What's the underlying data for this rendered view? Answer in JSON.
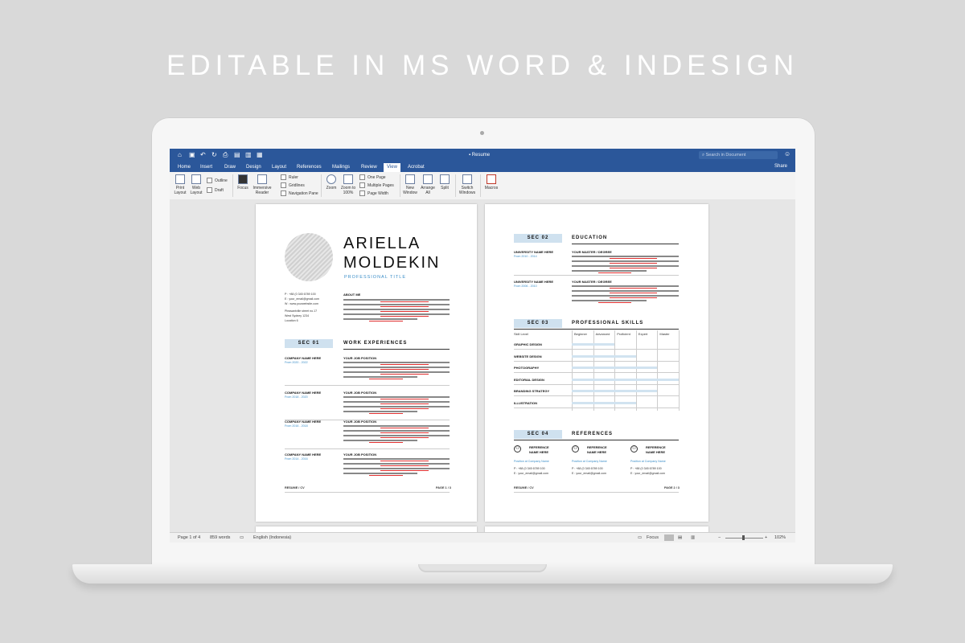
{
  "headline": "EDITABLE IN MS WORD & INDESIGN",
  "window": {
    "doc_title": "Resume",
    "search_placeholder": "Search in Document"
  },
  "tabs": [
    "Home",
    "Insert",
    "Draw",
    "Design",
    "Layout",
    "References",
    "Mailings",
    "Review",
    "View",
    "Acrobat"
  ],
  "active_tab": "View",
  "share_label": "Share",
  "ribbon": {
    "print_layout": "Print Layout",
    "web_layout": "Web Layout",
    "outline": "Outline",
    "draft": "Draft",
    "focus": "Focus",
    "immersive_reader": "Immersive Reader",
    "ruler": "Ruler",
    "gridlines": "Gridlines",
    "navigation_pane": "Navigation Pane",
    "zoom": "Zoom",
    "zoom_100": "Zoom to 100%",
    "one_page": "One Page",
    "multiple_pages": "Multiple Pages",
    "page_width": "Page Width",
    "new_window": "New Window",
    "arrange_all": "Arrange All",
    "split": "Split",
    "switch_windows": "Switch Windows",
    "macros": "Macros"
  },
  "status": {
    "page": "Page 1 of 4",
    "words": "859 words",
    "language": "English (Indonesia)",
    "focus": "Focus",
    "zoom": "102%",
    "zoom_minus": "−",
    "zoom_plus": "+"
  },
  "resume": {
    "first_name": "ARIELLA",
    "last_name": "MOLDEKIN",
    "professional_title": "PROFESSIONAL TITLE",
    "contact": [
      "P : +88 (0 345 6789 100",
      "E : your_email@gmail.com",
      "W : www.yourwebsite.com"
    ],
    "address": [
      "Pleasantville street no.17",
      "West Sydney 1234",
      "Location 6"
    ],
    "about_title": "ABOUT ME",
    "sec01": "SEC 01",
    "work_title": "WORK EXPERIENCES",
    "jobs": [
      {
        "company": "COMPANY NAME HERE",
        "dates": "From 2020 - 2022",
        "position": "YOUR JOB POSITION"
      },
      {
        "company": "COMPANY NAME HERE",
        "dates": "From 2018 - 2020",
        "position": "YOUR JOB POSITION"
      },
      {
        "company": "COMPANY NAME HERE",
        "dates": "From 2016 - 2018",
        "position": "YOUR JOB POSITION"
      },
      {
        "company": "COMPANY NAME HERE",
        "dates": "From 2014 - 2016",
        "position": "YOUR JOB POSITION"
      }
    ],
    "footer_left": "RESUME / CV",
    "footer_page1": "PAGE 1 / 3",
    "sec02": "SEC 02",
    "education_title": "EDUCATION",
    "education": [
      {
        "school": "UNIVERSITY NAME HERE",
        "dates": "From 2010 - 2014",
        "degree": "YOUR MASTER / DEGREE"
      },
      {
        "school": "UNIVERSITY NAME HERE",
        "dates": "From 2006 - 2010",
        "degree": "YOUR MASTER / DEGREE"
      }
    ],
    "sec03": "SEC 03",
    "skills_title": "PROFESSIONAL SKILLS",
    "skill_level_label": "Skill Level",
    "levels": [
      "Beginner",
      "Advanced",
      "Proficient",
      "Expert",
      "Master"
    ],
    "skills": [
      {
        "name": "GRAPHIC DESIGN",
        "level": 0.4
      },
      {
        "name": "WEBSITE DESIGN",
        "level": 0.6
      },
      {
        "name": "PHOTOGRAPHY",
        "level": 0.8
      },
      {
        "name": "EDITORIAL DESIGN",
        "level": 1.0
      },
      {
        "name": "BRANDING STRATEGY",
        "level": 0.8
      },
      {
        "name": "ILLUSTRATION",
        "level": 0.6
      }
    ],
    "sec04": "SEC 04",
    "references_title": "REFERENCES",
    "references": [
      {
        "name1": "REFERENCE",
        "name2": "NAME HERE",
        "position": "Position at Company Name",
        "phone": "P : +88 (0 345 6789 100",
        "email": "E : your_email@gmail.com"
      },
      {
        "name1": "REFERENCE",
        "name2": "NAME HERE",
        "position": "Position at Company Name",
        "phone": "P : +88 (0 345 6789 100",
        "email": "E : your_email@gmail.com"
      },
      {
        "name1": "REFERENCE",
        "name2": "NAME HERE",
        "position": "Position at Company Name",
        "phone": "P : +88 (0 345 6789 100",
        "email": "E : your_email@gmail.com"
      }
    ],
    "footer_page2": "PAGE 2 / 3"
  },
  "colors": {
    "word_blue": "#2b579a",
    "accent_blue": "#3b8ec8",
    "section_fill": "#cfe1ef"
  }
}
